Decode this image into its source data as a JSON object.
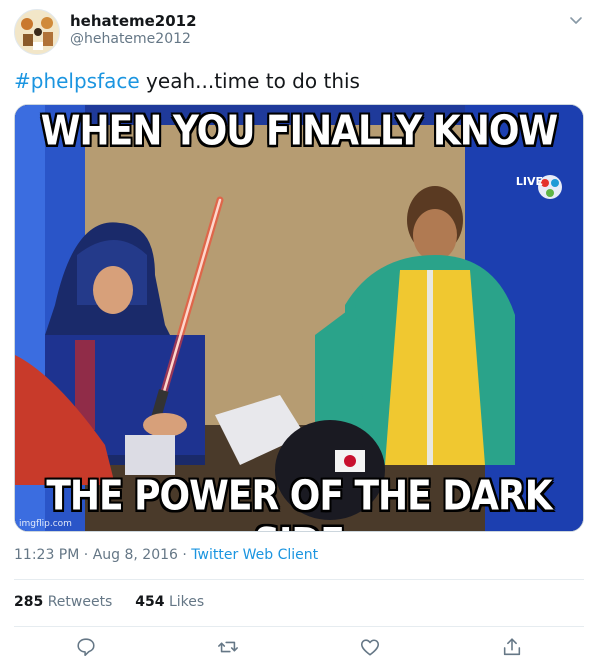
{
  "user": {
    "display_name": "hehateme2012",
    "handle": "@hehateme2012"
  },
  "tweet": {
    "hashtag": "#phelpsface",
    "text": " yeah...time to do this"
  },
  "media": {
    "top_caption": "WHEN YOU FINALLY KNOW",
    "bottom_caption": "THE POWER OF THE DARK SIDE",
    "watermark": "imgflip.com",
    "badge": "LIVE"
  },
  "meta": {
    "time": "11:23 PM",
    "separator1": " · ",
    "date": "Aug 8, 2016",
    "separator2": " · ",
    "client": "Twitter Web Client"
  },
  "stats": {
    "retweets_count": "285",
    "retweets_label": "Retweets",
    "likes_count": "454",
    "likes_label": "Likes"
  },
  "actions": {
    "reply_icon": "reply-icon",
    "retweet_icon": "retweet-icon",
    "like_icon": "heart-icon",
    "share_icon": "share-icon"
  },
  "colors": {
    "link": "#1b95e0",
    "text": "#14171a",
    "secondary": "#657786",
    "icon": "#657786"
  }
}
